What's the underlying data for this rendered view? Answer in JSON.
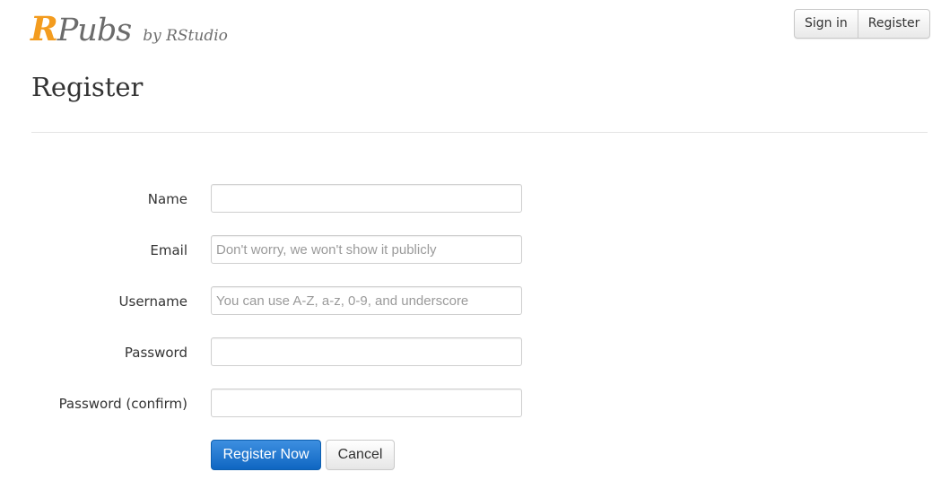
{
  "header": {
    "logo_r": "R",
    "logo_pubs": "Pubs",
    "logo_by": "by RStudio",
    "sign_in_label": "Sign in",
    "register_label": "Register"
  },
  "page": {
    "title": "Register"
  },
  "form": {
    "name": {
      "label": "Name",
      "value": "",
      "placeholder": ""
    },
    "email": {
      "label": "Email",
      "value": "",
      "placeholder": "Don't worry, we won't show it publicly"
    },
    "username": {
      "label": "Username",
      "value": "",
      "placeholder": "You can use A-Z, a-z, 0-9, and underscore"
    },
    "password": {
      "label": "Password",
      "value": "",
      "placeholder": ""
    },
    "password_confirm": {
      "label": "Password (confirm)",
      "value": "",
      "placeholder": ""
    },
    "submit_label": "Register Now",
    "cancel_label": "Cancel"
  },
  "colors": {
    "brand_orange": "#f39c1f",
    "primary_blue": "#1a6fc9"
  }
}
